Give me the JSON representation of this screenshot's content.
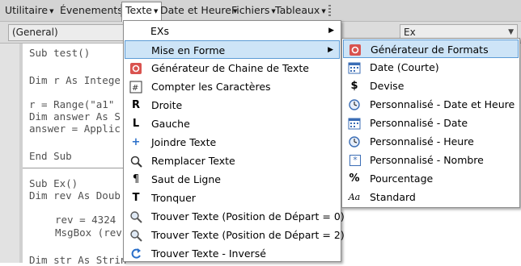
{
  "menubar": {
    "items": [
      {
        "label": "Utilitaire"
      },
      {
        "label": "Évenements"
      },
      {
        "label": "Texte"
      },
      {
        "label": "Date et Heure"
      },
      {
        "label": "Fichiers"
      },
      {
        "label": "Tableaux"
      }
    ]
  },
  "toolbar": {
    "object_combo": "(General)",
    "proc_combo": "Ex"
  },
  "code": {
    "lines": [
      "Sub test()",
      "Dim r As Intege",
      "r = Range(\"a1\"",
      "Dim answer As S",
      "answer = Applic",
      "End Sub",
      "Sub Ex()",
      "Dim rev As Doub",
      "rev = 4324",
      "MsgBox (rev",
      "Dim str As Strin"
    ]
  },
  "texte_menu": {
    "items": [
      {
        "label": "EXs",
        "icon": "none"
      },
      {
        "label": "Mise en Forme",
        "icon": "none"
      },
      {
        "label": "Générateur de Chaine de Texte",
        "icon": "generator-icon"
      },
      {
        "label": "Compter les Caractères",
        "icon": "count-icon"
      },
      {
        "label": "Droite",
        "icon": "letter-r-icon",
        "glyph": "R"
      },
      {
        "label": "Gauche",
        "icon": "letter-l-icon",
        "glyph": "L"
      },
      {
        "label": "Joindre Texte",
        "icon": "plus-icon",
        "glyph": "+"
      },
      {
        "label": "Remplacer Texte",
        "icon": "replace-icon"
      },
      {
        "label": "Saut de Ligne",
        "icon": "pilcrow-icon",
        "glyph": "¶"
      },
      {
        "label": "Tronquer",
        "icon": "letter-t-icon",
        "glyph": "T"
      },
      {
        "label": "Trouver Texte (Position de Départ = 0)",
        "icon": "search-icon"
      },
      {
        "label": "Trouver Texte (Position de Départ = 2)",
        "icon": "search-icon"
      },
      {
        "label": "Trouver Texte - Inversé",
        "icon": "reverse-icon"
      }
    ]
  },
  "format_menu": {
    "items": [
      {
        "label": "Générateur de Formats",
        "icon": "generator-icon"
      },
      {
        "label": "Date (Courte)",
        "icon": "calendar-icon"
      },
      {
        "label": "Devise",
        "icon": "currency-icon",
        "glyph": "$"
      },
      {
        "label": "Personnalisé - Date et Heure",
        "icon": "clock-icon"
      },
      {
        "label": "Personnalisé - Date",
        "icon": "calendar-icon"
      },
      {
        "label": "Personnalisé - Heure",
        "icon": "clock-icon"
      },
      {
        "label": "Personnalisé - Nombre",
        "icon": "number-icon",
        "glyph": "*"
      },
      {
        "label": "Pourcentage",
        "icon": "percent-icon",
        "glyph": "%"
      },
      {
        "label": "Standard",
        "icon": "font-aa-icon",
        "glyph": "Aa"
      }
    ]
  },
  "colors": {
    "highlight_bg": "#cde4f7",
    "highlight_border": "#5b9bd5",
    "generator_red": "#d9534f"
  }
}
